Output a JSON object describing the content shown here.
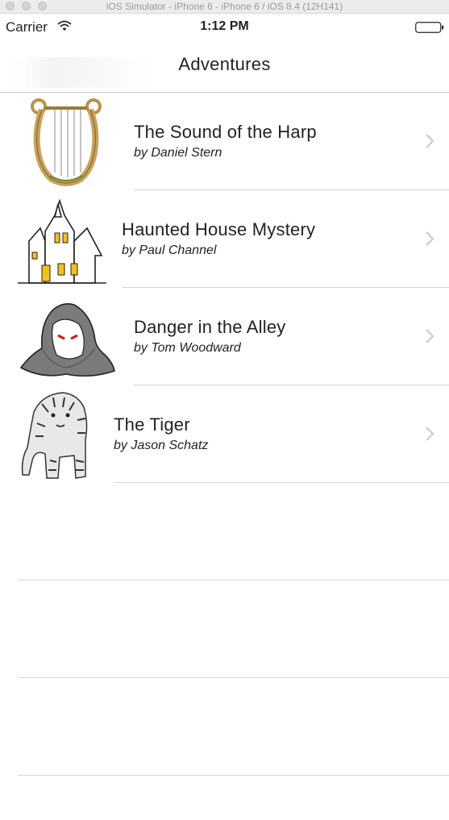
{
  "simulator": {
    "title": "iOS Simulator - iPhone 6 - iPhone 6 / iOS 8.4 (12H141)"
  },
  "status_bar": {
    "carrier": "Carrier",
    "time": "1:12 PM",
    "wifi_icon": "wifi-icon",
    "battery_icon": "battery-icon"
  },
  "nav": {
    "title": "Adventures"
  },
  "adventures": [
    {
      "title": "The Sound of the Harp",
      "author": "by Daniel Stern",
      "icon": "harp-icon"
    },
    {
      "title": "Haunted House Mystery",
      "author": "by Paul Channel",
      "icon": "haunted-house-icon"
    },
    {
      "title": "Danger in the Alley",
      "author": "by Tom Woodward",
      "icon": "hooded-figure-icon"
    },
    {
      "title": "The Tiger",
      "author": "by Jason Schatz",
      "icon": "tiger-icon"
    }
  ],
  "colors": {
    "separator": "#d4d4d8",
    "chevron": "#c7c7cc",
    "text": "#222222"
  }
}
